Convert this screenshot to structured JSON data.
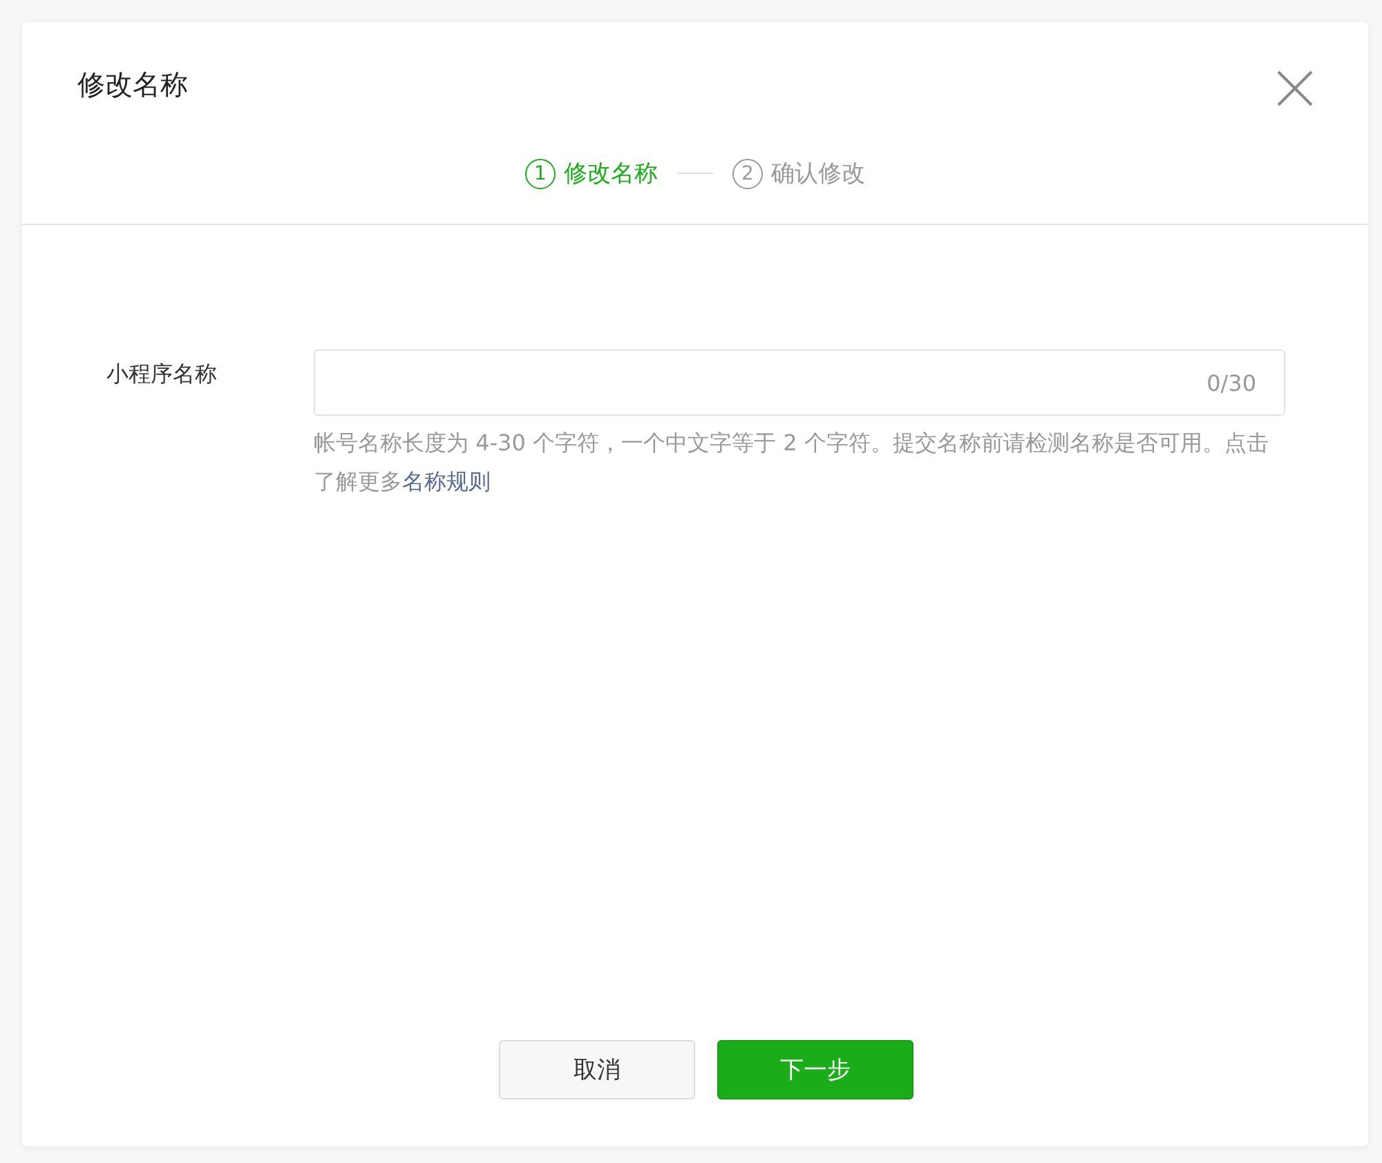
{
  "dialog": {
    "title": "修改名称"
  },
  "steps": [
    {
      "number": "1",
      "label": "修改名称",
      "selected": true
    },
    {
      "number": "2",
      "label": "确认修改",
      "selected": false
    }
  ],
  "form": {
    "label": "小程序名称",
    "counter": "0/30",
    "hint": "帐号名称长度为 4-30 个字符，一个中文字等于 2 个字符。提交名称前请检测名称是否可用。点击了解更多",
    "hint_link": "名称规则"
  },
  "buttons": [
    {
      "label": "取消",
      "kind": "secondary"
    },
    {
      "label": "下一步",
      "kind": "primary"
    }
  ]
}
